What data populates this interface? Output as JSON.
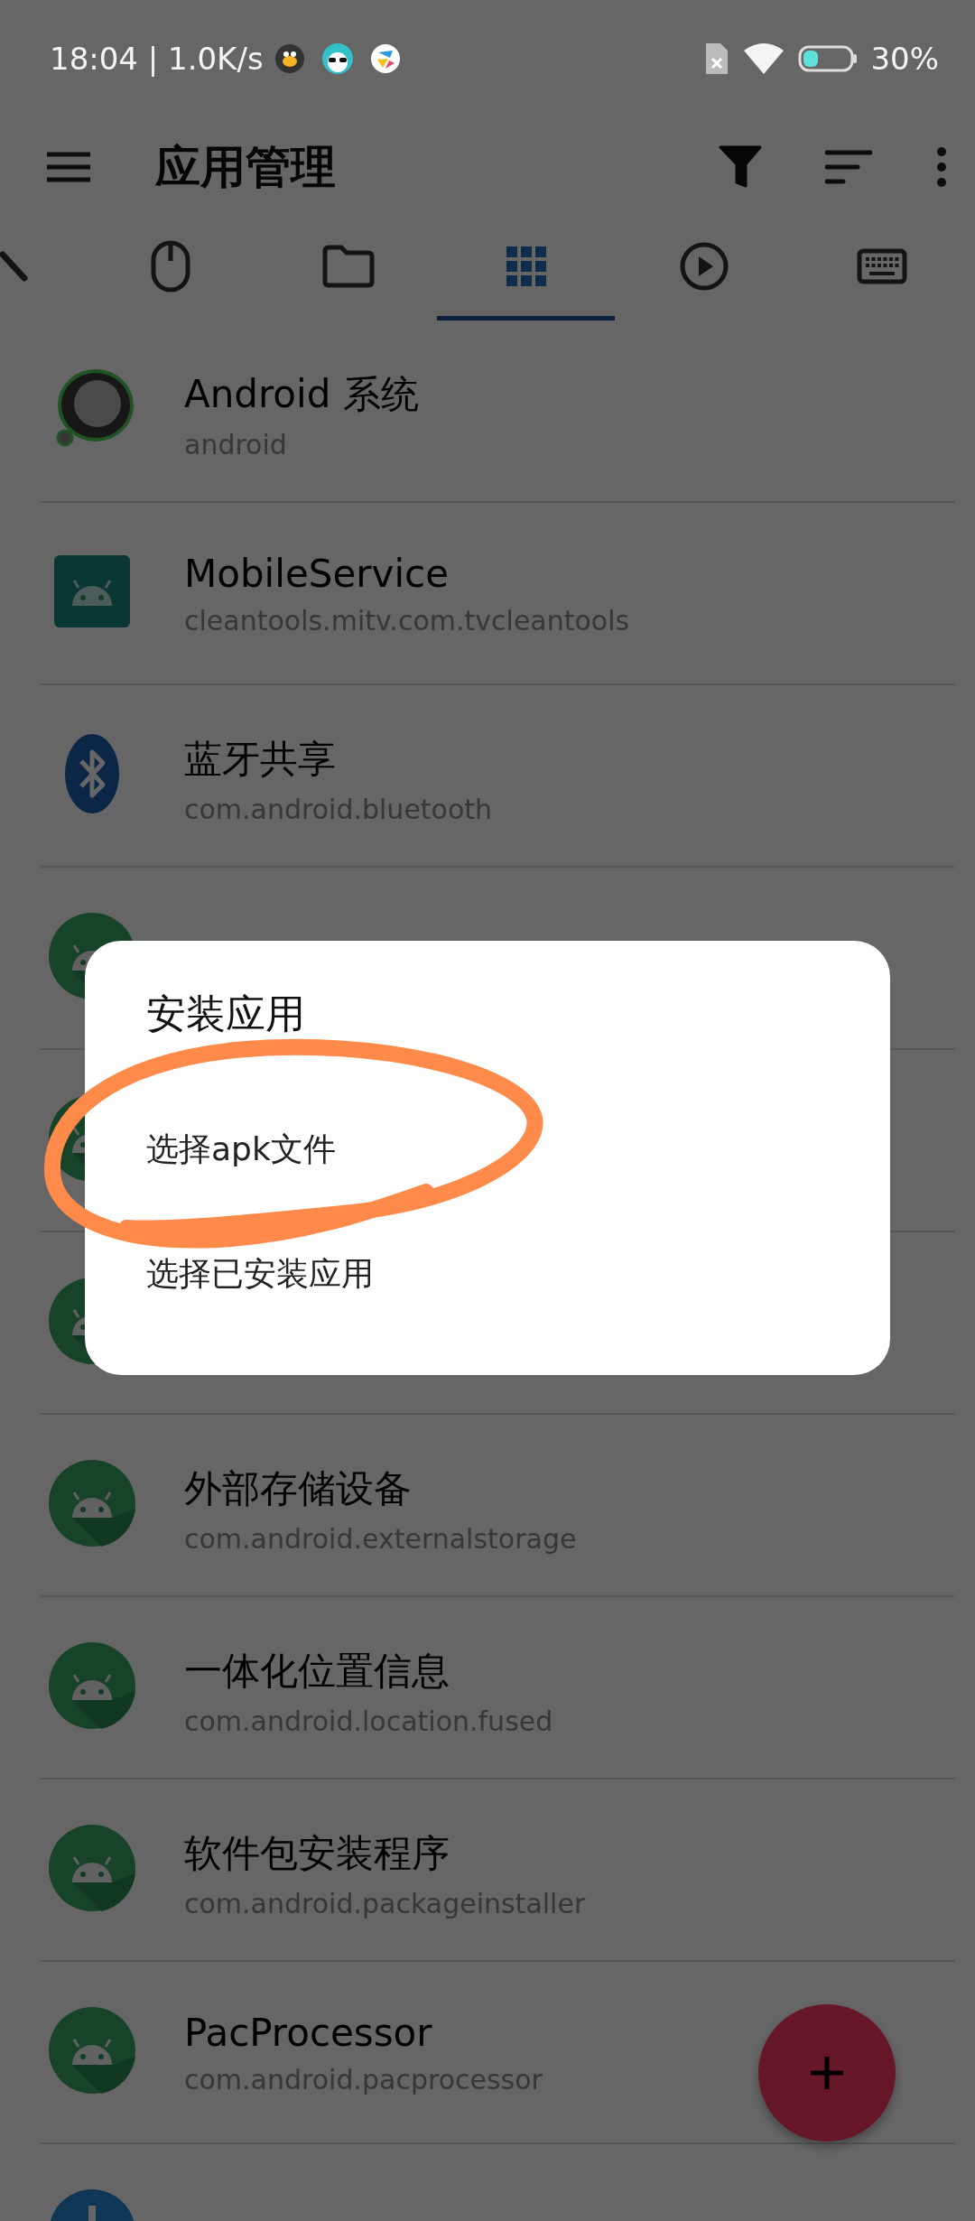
{
  "status_bar": {
    "time_speed": "18:04 | 1.0K/s",
    "battery_percent": "30%"
  },
  "toolbar": {
    "title": "应用管理"
  },
  "tabs": [
    {
      "kind": "pen",
      "selected": false
    },
    {
      "kind": "mouse",
      "selected": false
    },
    {
      "kind": "folder",
      "selected": false
    },
    {
      "kind": "grid",
      "selected": true
    },
    {
      "kind": "play",
      "selected": false
    },
    {
      "kind": "keyboard",
      "selected": false
    }
  ],
  "apps": [
    {
      "kind": "system",
      "name": "Android 系统",
      "package": "android"
    },
    {
      "kind": "tv",
      "name": "MobileService",
      "package": "cleantools.mitv.com.tvcleantools"
    },
    {
      "kind": "bluetooth",
      "name": "蓝牙共享",
      "package": "com.android.bluetooth"
    },
    {
      "kind": "android"
    },
    {
      "kind": "android"
    },
    {
      "kind": "android"
    },
    {
      "kind": "android",
      "name": "外部存储设备",
      "package": "com.android.externalstorage"
    },
    {
      "kind": "android",
      "name": "一体化位置信息",
      "package": "com.android.location.fused"
    },
    {
      "kind": "android",
      "name": "软件包安装程序",
      "package": "com.android.packageinstaller"
    },
    {
      "kind": "android",
      "name": "PacProcessor",
      "package": "com.android.pacprocessor"
    },
    {
      "kind": "download"
    }
  ],
  "dialog": {
    "title": "安装应用",
    "options": [
      {
        "label": "选择apk文件",
        "circled": true
      },
      {
        "label": "选择已安装应用",
        "circled": false
      }
    ]
  }
}
